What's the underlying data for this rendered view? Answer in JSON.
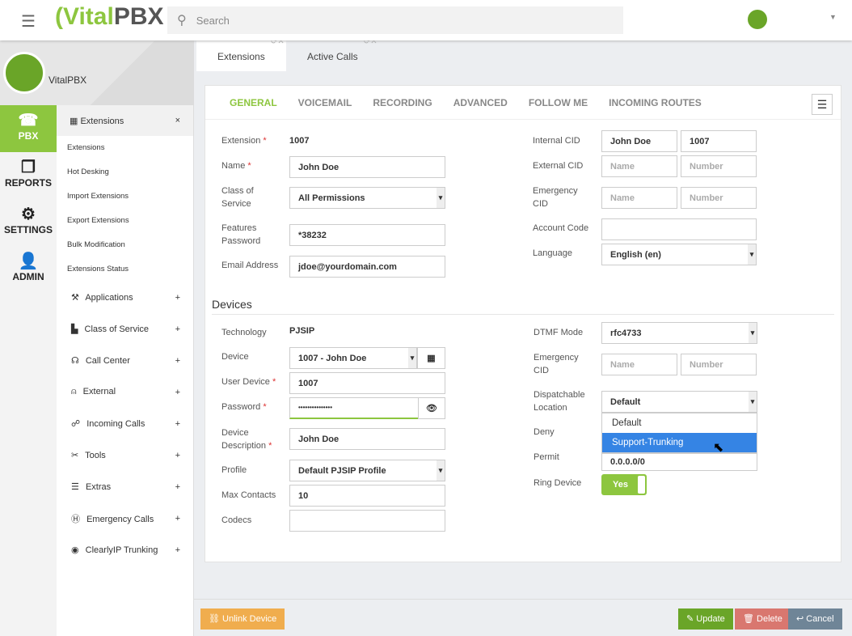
{
  "header": {
    "logo": "VitalPBX",
    "search_placeholder": "Search"
  },
  "profile": {
    "org": "VitalPBX"
  },
  "nav": [
    {
      "label": "PBX",
      "icon": "phone-icon",
      "active": true
    },
    {
      "label": "REPORTS",
      "icon": "files-icon"
    },
    {
      "label": "SETTINGS",
      "icon": "gears-icon"
    },
    {
      "label": "ADMIN",
      "icon": "user-icon"
    }
  ],
  "submenu": {
    "header": "Extensions",
    "close": "×",
    "items": [
      "Extensions",
      "Hot Desking",
      "Import Extensions",
      "Export Extensions",
      "Bulk Modification",
      "Extensions Status"
    ],
    "groups": [
      {
        "label": "Applications",
        "icon": "⚒"
      },
      {
        "label": "Class of Service",
        "icon": "▙"
      },
      {
        "label": "Call Center",
        "icon": "☊"
      },
      {
        "label": "External",
        "icon": "⍝"
      },
      {
        "label": "Incoming Calls",
        "icon": "☍"
      },
      {
        "label": "Tools",
        "icon": "✂"
      },
      {
        "label": "Extras",
        "icon": "☰"
      },
      {
        "label": "Emergency Calls",
        "icon": "Ⓗ"
      },
      {
        "label": "ClearlyIP Trunking",
        "icon": "◉"
      }
    ],
    "expand": "+"
  },
  "tabs": [
    {
      "label": "Extensions",
      "active": true
    },
    {
      "label": "Active Calls"
    }
  ],
  "form_tabs": [
    "GENERAL",
    "VOICEMAIL",
    "RECORDING",
    "ADVANCED",
    "FOLLOW ME",
    "INCOMING ROUTES"
  ],
  "general": {
    "extension_label": "Extension",
    "extension": "1007",
    "name_label": "Name",
    "name": "John Doe",
    "cos_label": "Class of Service",
    "cos": "All Permissions",
    "features_label": "Features Password",
    "features": "*38232",
    "email_label": "Email Address",
    "email": "jdoe@yourdomain.com",
    "internal_cid_label": "Internal CID",
    "internal_cid_name": "John Doe",
    "internal_cid_number": "1007",
    "external_cid_label": "External CID",
    "emergency_cid_label": "Emergency CID",
    "name_ph": "Name",
    "number_ph": "Number",
    "account_code_label": "Account Code",
    "language_label": "Language",
    "language": "English (en)"
  },
  "devices": {
    "title": "Devices",
    "technology_label": "Technology",
    "technology": "PJSIP",
    "device_label": "Device",
    "device": "1007 - John Doe",
    "user_device_label": "User Device",
    "user_device": "1007",
    "password_label": "Password",
    "password": "•••••••••••••••",
    "description_label": "Device Description",
    "description": "John Doe",
    "profile_label": "Profile",
    "profile": "Default PJSIP Profile",
    "max_contacts_label": "Max Contacts",
    "max_contacts": "10",
    "codecs_label": "Codecs",
    "dtmf_label": "DTMF Mode",
    "dtmf": "rfc4733",
    "emergency_cid_label": "Emergency CID",
    "dispatch_label": "Dispatchable Location",
    "dispatch": "Default",
    "dispatch_options": [
      "Default",
      "Support-Trunking"
    ],
    "deny_label": "Deny",
    "permit_label": "Permit",
    "permit": "0.0.0.0/0",
    "ring_label": "Ring Device",
    "ring": "Yes"
  },
  "footer": {
    "unlink": "Unlink Device",
    "update": "Update",
    "delete": "Delete",
    "cancel": "Cancel"
  },
  "colors": {
    "accent": "#8dc63f",
    "unlink": "#f0ad4e",
    "delete": "#d9776f",
    "cancel": "#6f8597",
    "highlight": "#3584e4"
  }
}
